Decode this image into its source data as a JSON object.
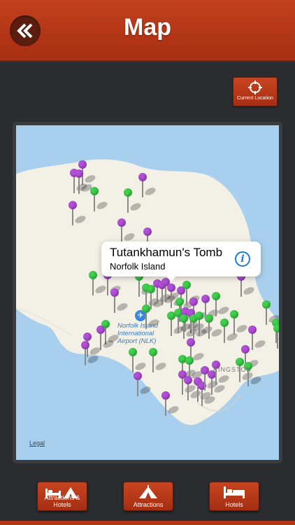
{
  "header": {
    "title": "Map"
  },
  "current_location": {
    "label": "Current Location"
  },
  "callout": {
    "title": "Tutankhamun's Tomb",
    "subtitle": "Norfolk Island"
  },
  "map": {
    "airport_label_1": "Norfolk Island",
    "airport_label_2": "International",
    "airport_label_3": "Airport (NLK)",
    "town_label": "KINGSTON",
    "legal": "Legal"
  },
  "tabs": [
    {
      "label": "Attractions & Hotels",
      "icon": "bed-and-tent-icon"
    },
    {
      "label": "Attractions",
      "icon": "tent-icon"
    },
    {
      "label": "Hotels",
      "icon": "bed-icon"
    }
  ],
  "colors": {
    "header": "#b8391a",
    "pin_purple": "#b24fd8",
    "pin_green": "#3fcf4d",
    "map_water": "#a8d0ee",
    "map_land": "#f3f0e6"
  }
}
